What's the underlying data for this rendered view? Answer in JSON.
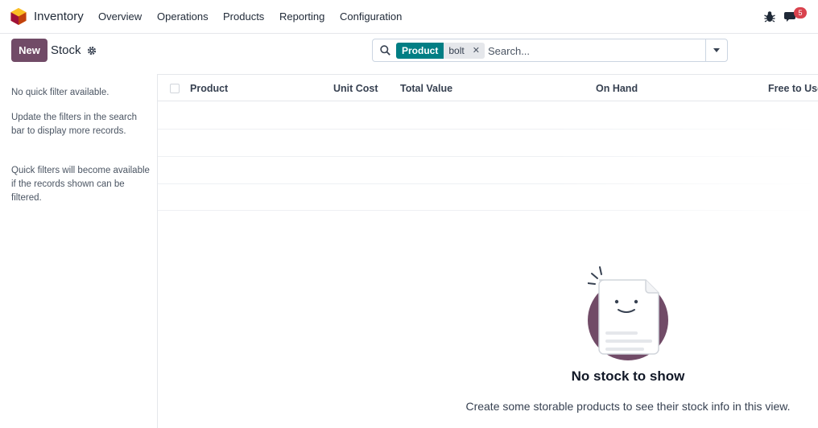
{
  "navbar": {
    "app_name": "Inventory",
    "menu": [
      "Overview",
      "Operations",
      "Products",
      "Reporting",
      "Configuration"
    ],
    "icons": {
      "logo": "inventory-app-logo",
      "debug": "bug-icon",
      "messages": "chat-icon"
    },
    "message_count": "5"
  },
  "control_panel": {
    "new_label": "New",
    "title": "Stock",
    "search": {
      "facet_label": "Product",
      "facet_value": "bolt",
      "placeholder": "Search..."
    }
  },
  "side_panel": {
    "messages": [
      "No quick filter available.",
      "Update the filters in the search bar to display more records.",
      "Quick filters will become available if the records shown can be filtered."
    ]
  },
  "list": {
    "columns": [
      "Product",
      "Unit Cost",
      "Total Value",
      "On Hand",
      "Free to Use"
    ],
    "rows": []
  },
  "empty_state": {
    "title": "No stock to show",
    "subtitle": "Create some storable products to see their stock info in this view."
  },
  "colors": {
    "brand": "#714b67",
    "facet": "#017e84",
    "badge": "#d9424d"
  }
}
